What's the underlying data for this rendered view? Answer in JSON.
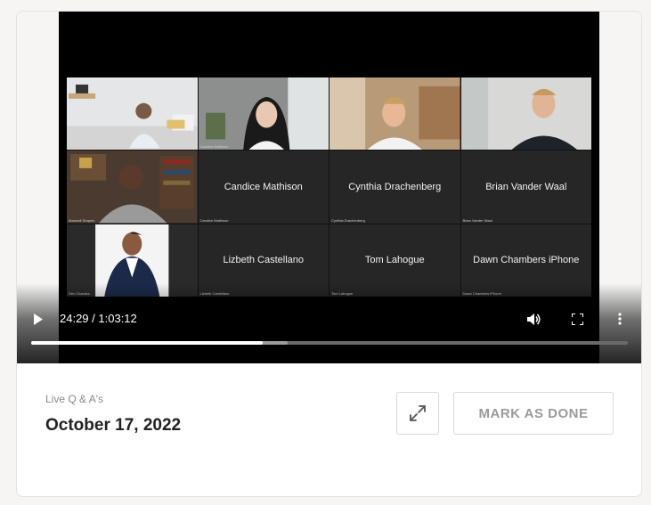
{
  "player": {
    "current_time": "24:29",
    "separator": " / ",
    "duration": "1:03:12",
    "played_fraction": 0.3875,
    "buffered_fraction": 0.43,
    "icons": {
      "play": "play-icon",
      "volume": "volume-icon",
      "fullscreen": "fullscreen-icon",
      "more": "more-vertical-icon"
    }
  },
  "participants": [
    {
      "name": "",
      "tag": "Mackenzie Beltran",
      "has_video": true
    },
    {
      "name": "",
      "tag": "Candice Mathison",
      "has_video": true
    },
    {
      "name": "",
      "tag": "Cynthia",
      "has_video": true
    },
    {
      "name": "",
      "tag": "Brian",
      "has_video": true
    },
    {
      "name": "",
      "tag": "Maxwell Shapiro",
      "has_video": true
    },
    {
      "name": "Candice Mathison",
      "tag": "Candice Mathison",
      "has_video": false
    },
    {
      "name": "Cynthia Drachenberg",
      "tag": "Cynthia Drachenberg",
      "has_video": false
    },
    {
      "name": "Brian Vander Waal",
      "tag": "Brian Vander Waal",
      "has_video": false
    },
    {
      "name": "",
      "tag": "Dev Chandra",
      "has_video": true
    },
    {
      "name": "Lizbeth Castellano",
      "tag": "Lizbeth Castellano",
      "has_video": false
    },
    {
      "name": "Tom Lahogue",
      "tag": "Tom Lahogue",
      "has_video": false
    },
    {
      "name": "Dawn Chambers iPhone",
      "tag": "Dawn Chambers iPhone",
      "has_video": false
    }
  ],
  "details": {
    "category": "Live Q & A's",
    "date": "October 17, 2022",
    "expand_icon": "expand-arrows-icon",
    "mark_done_label": "MARK AS DONE"
  }
}
